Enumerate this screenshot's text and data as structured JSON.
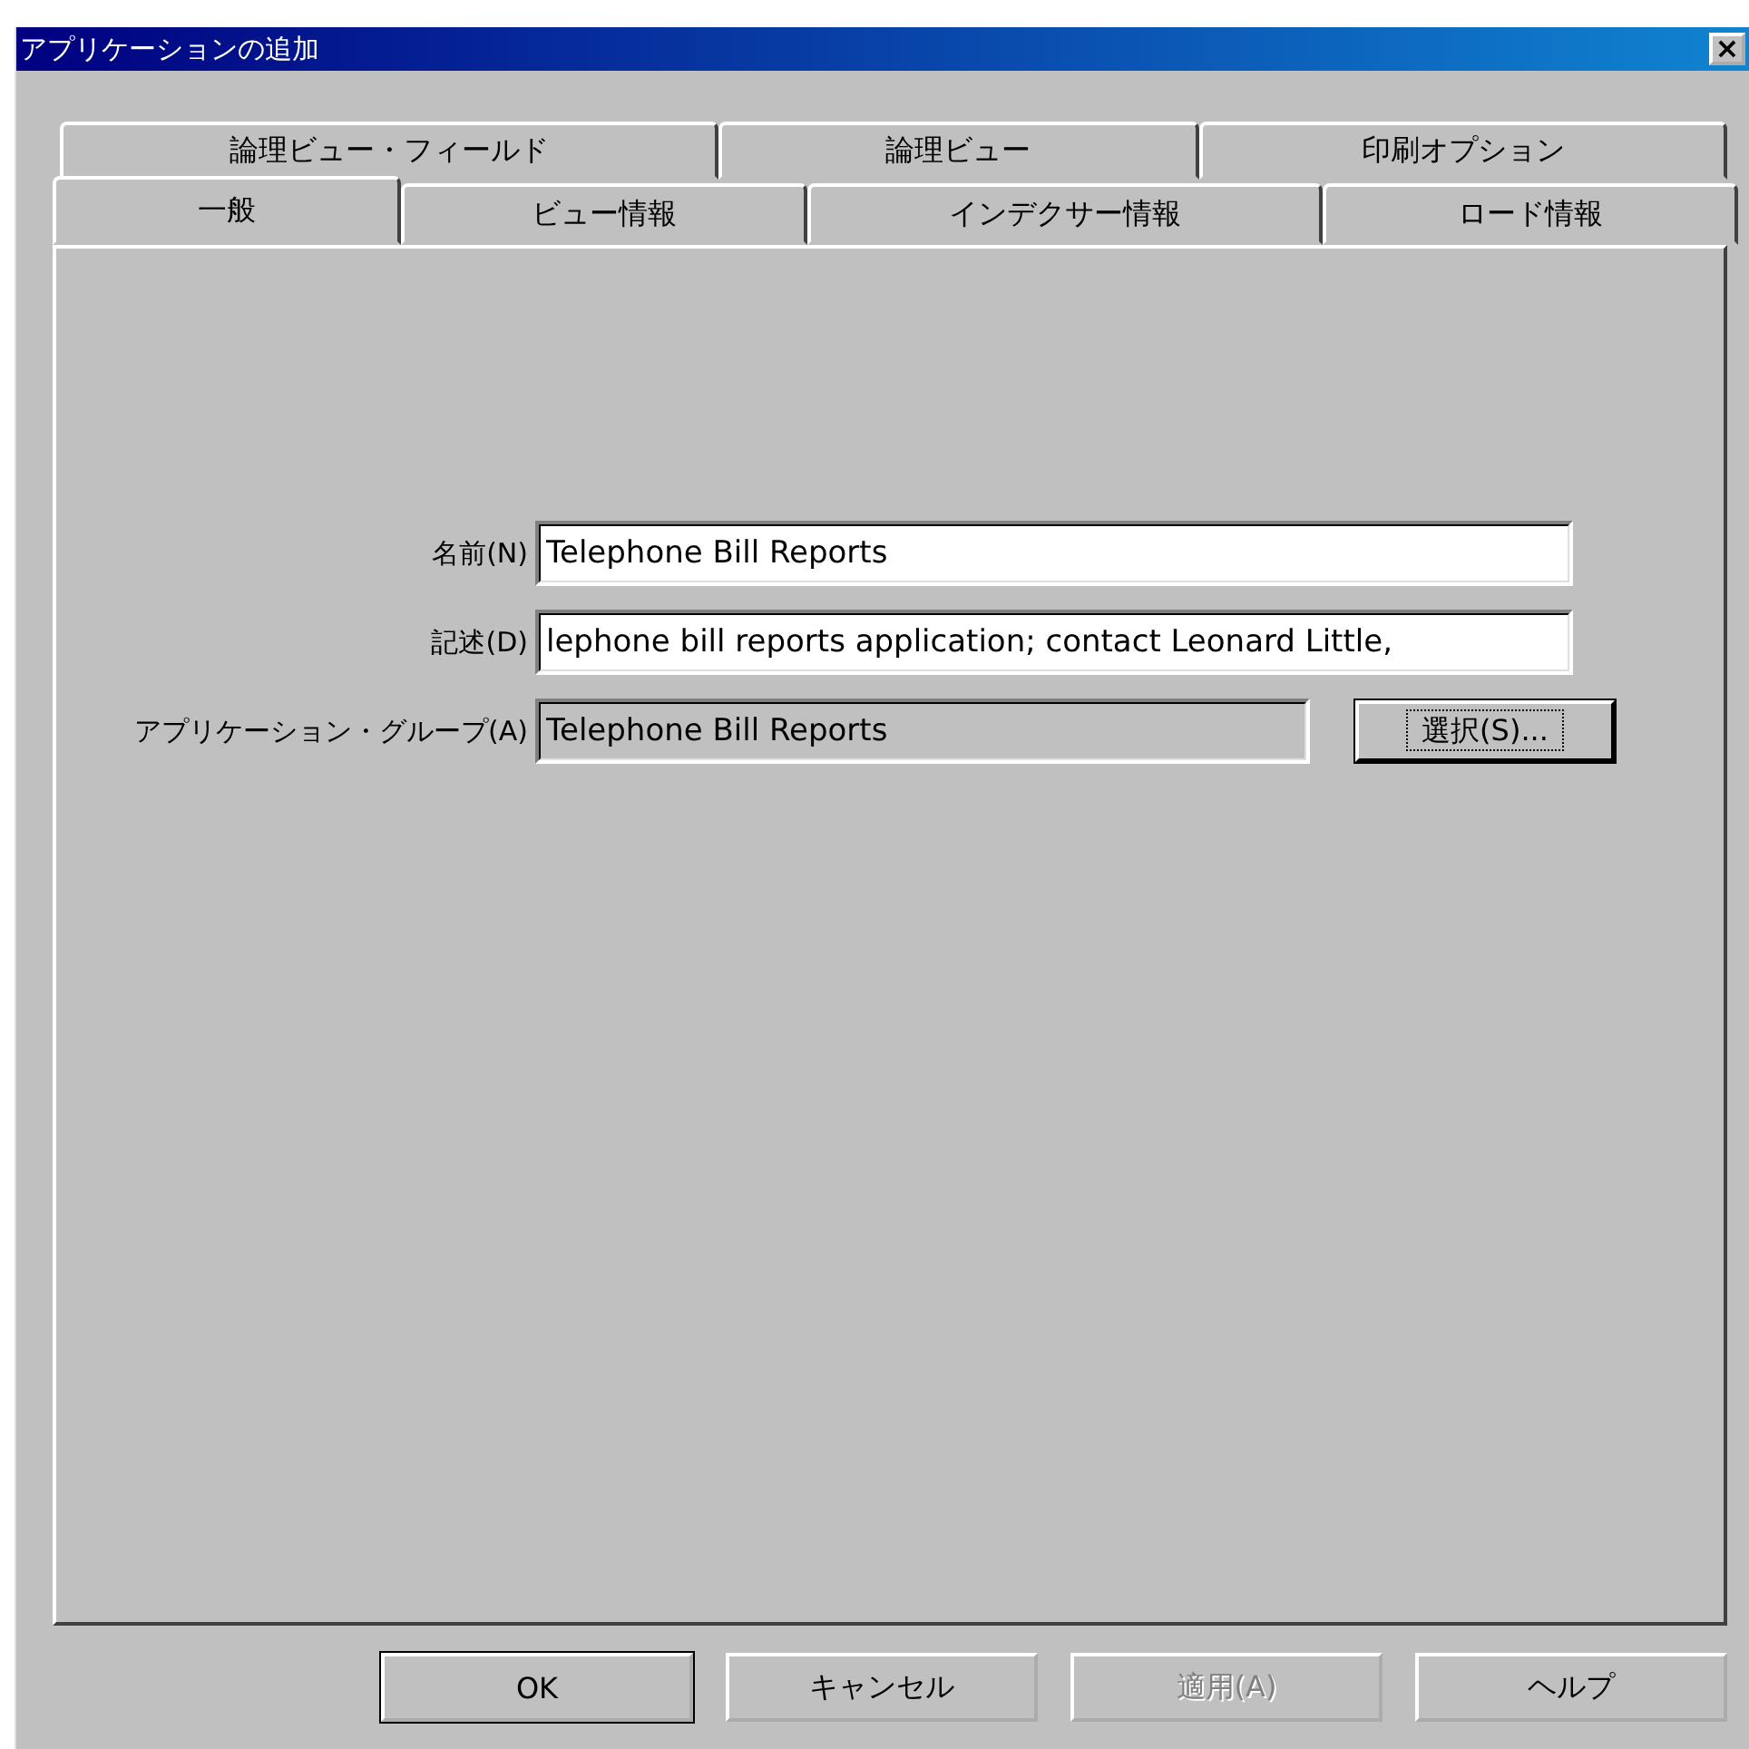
{
  "window": {
    "title": "アプリケーションの追加",
    "close": "×"
  },
  "tab_rows": [
    [
      {
        "label": "論理ビュー・フィールド",
        "selected": false
      },
      {
        "label": "論理ビュー",
        "selected": false
      },
      {
        "label": "印刷オプション",
        "selected": false
      }
    ],
    [
      {
        "label": "一般",
        "selected": true
      },
      {
        "label": "ビュー情報",
        "selected": false
      },
      {
        "label": "インデクサー情報",
        "selected": false
      },
      {
        "label": "ロード情報",
        "selected": false
      }
    ]
  ],
  "fields": [
    {
      "label": "名前(N)",
      "value": "Telephone Bill Reports",
      "readonly": false
    },
    {
      "label": "記述(D)",
      "value": "lephone bill reports application; contact Leonard Little,",
      "readonly": false
    },
    {
      "label": "アプリケーション・グループ(A)",
      "value": "Telephone Bill Reports",
      "readonly": true,
      "button": "選択(S)..."
    }
  ],
  "buttons": [
    {
      "label": "OK",
      "default": true,
      "disabled": false
    },
    {
      "label": "キャンセル",
      "default": false,
      "disabled": false
    },
    {
      "label": "適用(A)",
      "default": false,
      "disabled": true
    },
    {
      "label": "ヘルプ",
      "default": false,
      "disabled": false
    }
  ]
}
